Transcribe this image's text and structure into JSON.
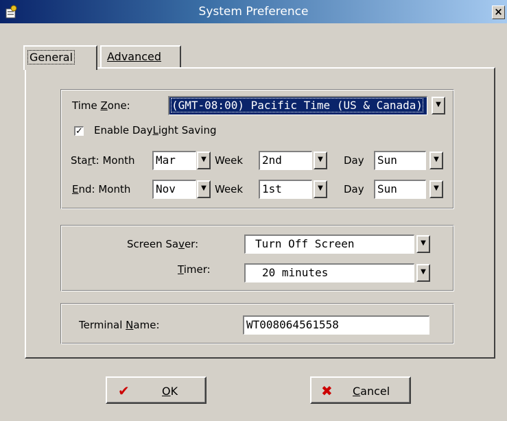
{
  "window": {
    "title": "System Preference",
    "close_glyph": "×",
    "icon": "settings-icon"
  },
  "tabs": [
    {
      "label": "General",
      "active": true
    },
    {
      "label": "Advanced",
      "active": false
    }
  ],
  "timezone": {
    "label_pre": "Time ",
    "label_ul": "Z",
    "label_post": "one:",
    "value": "(GMT-08:00) Pacific Time (US & Canada)"
  },
  "daylight": {
    "checked": true,
    "check_glyph": "✓",
    "label_pre": "Enable Day",
    "label_ul": "L",
    "label_post": "ight Saving"
  },
  "start": {
    "label_pre": "Sta",
    "label_ul": "r",
    "label_post": "t: Month",
    "month": "Mar",
    "week_label": "Week",
    "week": "2nd",
    "day_label": "Day",
    "day": "Sun"
  },
  "end": {
    "label_pre": "",
    "label_ul": "E",
    "label_post": "nd: Month",
    "month": "Nov",
    "week_label": "Week",
    "week": "1st",
    "day_label": "Day",
    "day": "Sun"
  },
  "screensaver": {
    "label_pre": "Screen Sa",
    "label_ul": "v",
    "label_post": "er:",
    "value": "Turn Off Screen"
  },
  "timer": {
    "label_pre": "",
    "label_ul": "T",
    "label_post": "imer:",
    "value": "20 minutes"
  },
  "terminal": {
    "label_pre": "Terminal ",
    "label_ul": "N",
    "label_post": "ame:",
    "value": "WT008064561558"
  },
  "buttons": {
    "ok": {
      "label_ul": "O",
      "label_post": "K",
      "icon": "checkmark-icon",
      "glyph": "✔"
    },
    "cancel": {
      "label_ul": "C",
      "label_post": "ancel",
      "icon": "cross-icon",
      "glyph": "✖"
    }
  },
  "dropdown_glyph": "▼",
  "colors": {
    "title_start": "#0a246a",
    "title_end": "#a6caf0",
    "selection": "#0a246a",
    "ok_icon": "#cc0000",
    "cancel_icon": "#cc0000"
  }
}
